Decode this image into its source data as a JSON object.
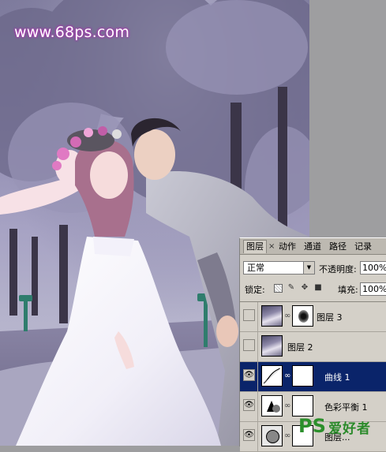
{
  "watermark": "www.68ps.com",
  "layers_panel": {
    "tabs": [
      "图层",
      "动作",
      "通道",
      "路径",
      "记录"
    ],
    "blend_mode": "正常",
    "opacity_label": "不透明度:",
    "opacity_value": "100%",
    "lock_label": "锁定:",
    "fill_label": "填充:",
    "fill_value": "100%",
    "layers": [
      {
        "name": "图层 3",
        "visible": false,
        "selected": false
      },
      {
        "name": "图层 2",
        "visible": false,
        "selected": false
      },
      {
        "name": "曲线 1",
        "visible": true,
        "selected": true
      },
      {
        "name": "色彩平衡 1",
        "visible": true,
        "selected": false
      },
      {
        "name": "图层...",
        "visible": true,
        "selected": false
      }
    ]
  },
  "site_badge": {
    "letters": "PS",
    "text": "爱好者"
  },
  "colors": {
    "selection": "#0a246a",
    "panel_bg": "#d4d0c8",
    "watermark_glow": "#b23bb8"
  }
}
